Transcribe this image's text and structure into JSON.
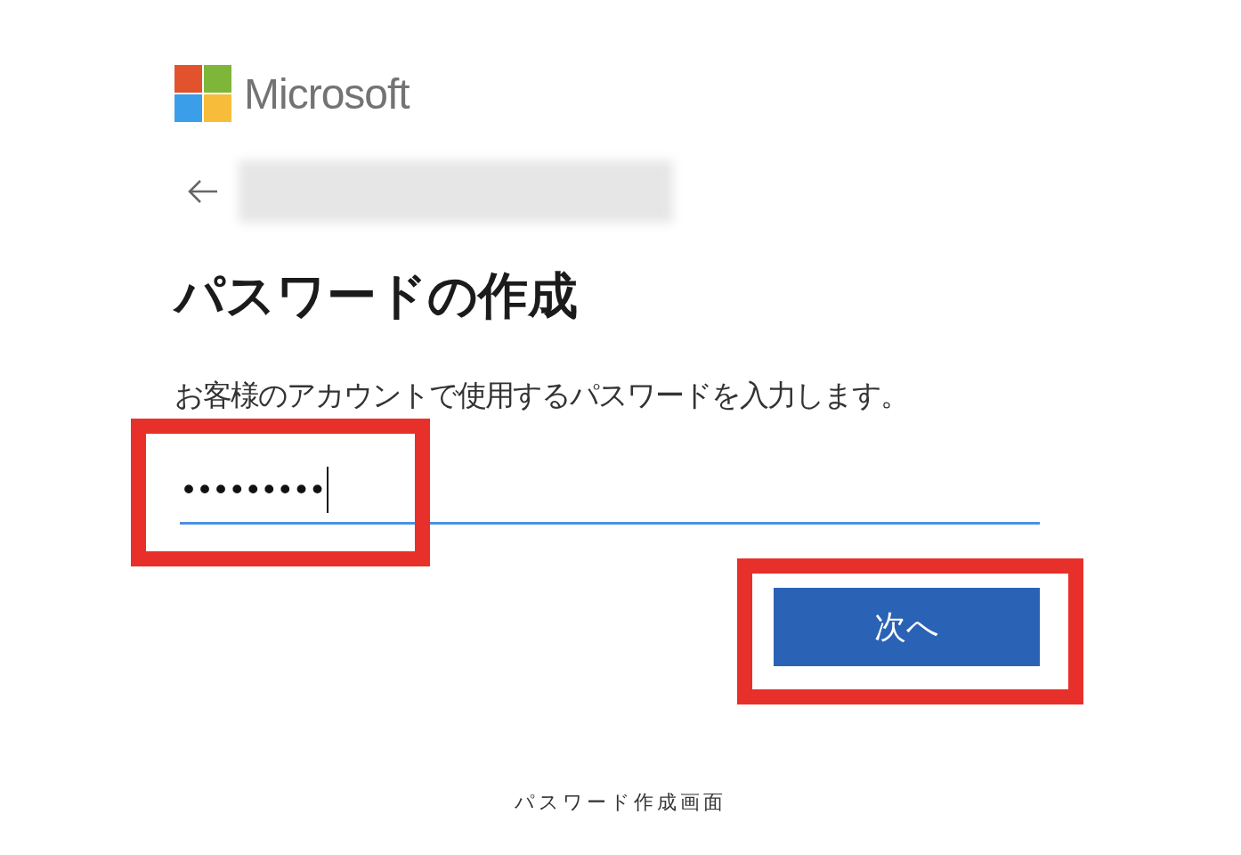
{
  "logo": {
    "text": "Microsoft"
  },
  "heading": "パスワードの作成",
  "description": "お客様のアカウントで使用するパスワードを入力します。",
  "password_field": {
    "value": "•••••••••"
  },
  "next_button": {
    "label": "次へ"
  },
  "caption": "パスワード作成画面"
}
